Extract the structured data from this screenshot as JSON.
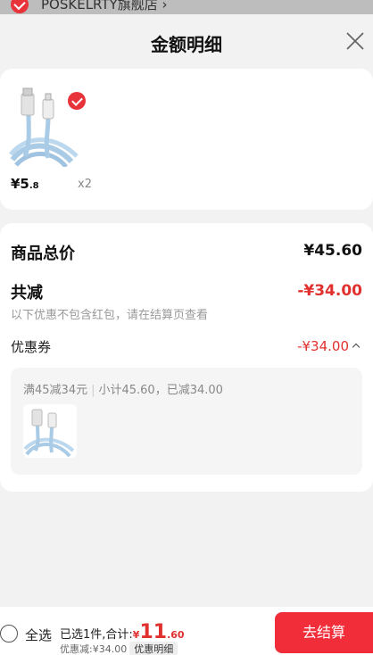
{
  "background_shop": {
    "name": "POSKELRTY旗舰店 ›"
  },
  "sheet": {
    "title": "金额明细"
  },
  "product": {
    "price_int": "¥5",
    "price_dec": ".8",
    "quantity": "x2"
  },
  "summary_card": {
    "total_label": "商品总价",
    "total_value": "¥45.60",
    "reduce_label": "共减",
    "reduce_value": "-¥34.00",
    "reduce_note": "以下优惠不包含红包，请在结算页查看",
    "coupon_label": "优惠券",
    "coupon_value": "-¥34.00",
    "coupon_rule": "满45减34元",
    "coupon_separator": "|",
    "coupon_detail": "小计45.60，已减34.00"
  },
  "footer": {
    "select_all": "全选",
    "selected_text": "已选1件,合计:",
    "total_symbol": "¥",
    "total_int": "11",
    "total_dec": ".60",
    "discount_text": "优惠减:¥34.00",
    "detail_tag": "优惠明细",
    "checkout_label": "去结算"
  },
  "colors": {
    "accent": "#e0312e",
    "checkout": "#f12d3a"
  },
  "icons": [
    "check-icon",
    "close-icon",
    "chevron-up-icon",
    "radio-icon"
  ]
}
